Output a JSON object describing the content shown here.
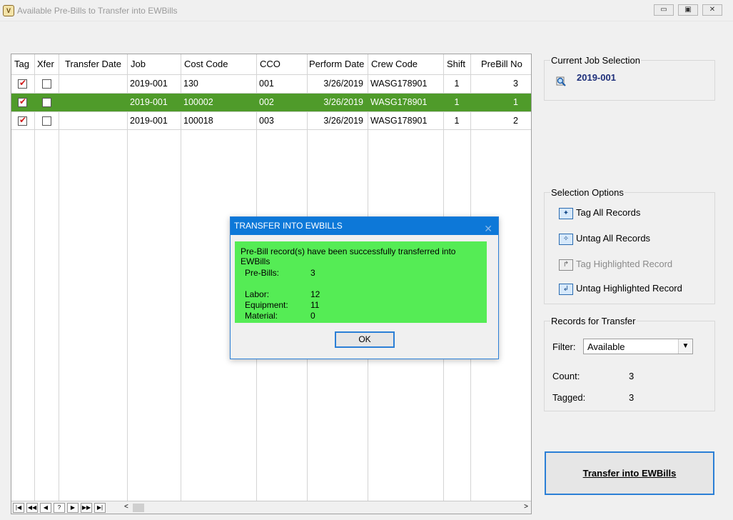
{
  "window": {
    "title": "Available Pre-Bills to Transfer into EWBills",
    "app_icon": "app-icon",
    "min_glyph": "▭",
    "max_glyph": "▣",
    "close_glyph": "✕"
  },
  "grid": {
    "columns": [
      "Tag",
      "Xfer",
      "Transfer Date",
      "Job",
      "Cost Code",
      "CCO",
      "Perform Date",
      "Crew Code",
      "Shift",
      "PreBill No"
    ],
    "rows": [
      {
        "tag": true,
        "xfer": false,
        "transfer_date": "",
        "job": "2019-001",
        "cost_code": "130",
        "cco": "001",
        "perform_date": "3/26/2019",
        "crew_code": "WASG178901",
        "shift": "1",
        "prebill_no": "3",
        "selected": false
      },
      {
        "tag": true,
        "xfer": false,
        "transfer_date": "",
        "job": "2019-001",
        "cost_code": "100002",
        "cco": "002",
        "perform_date": "3/26/2019",
        "crew_code": "WASG178901",
        "shift": "1",
        "prebill_no": "1",
        "selected": true
      },
      {
        "tag": true,
        "xfer": false,
        "transfer_date": "",
        "job": "2019-001",
        "cost_code": "100018",
        "cco": "003",
        "perform_date": "3/26/2019",
        "crew_code": "WASG178901",
        "shift": "1",
        "prebill_no": "2",
        "selected": false
      }
    ],
    "nav": [
      "|◀",
      "◀◀",
      "◀",
      "?",
      "▶",
      "▶▶",
      "▶|"
    ],
    "scroll_left": "<",
    "scroll_right": ">"
  },
  "job_selection": {
    "title": "Current Job Selection",
    "value": "2019-001",
    "icon": "magnifier-icon"
  },
  "selection_options": {
    "title": "Selection Options",
    "tag_all": "Tag All Records",
    "untag_all": "Untag All Records",
    "tag_highlighted": "Tag Highlighted Record",
    "untag_highlighted": "Untag Highlighted Record"
  },
  "records": {
    "title": "Records for Transfer",
    "filter_label": "Filter:",
    "filter_value": "Available",
    "count_label": "Count:",
    "count_value": "3",
    "tagged_label": "Tagged:",
    "tagged_value": "3"
  },
  "transfer_button": "Transfer into EWBills",
  "dialog": {
    "title": "TRANSFER INTO EWBILLS",
    "close_glyph": "✕",
    "message": "Pre-Bill record(s) have been successfully transferred into EWBills",
    "prebills_label": "Pre-Bills:",
    "prebills_value": "3",
    "labor_label": "Labor:",
    "labor_value": "12",
    "equipment_label": "Equipment:",
    "equipment_value": "11",
    "material_label": "Material:",
    "material_value": "0",
    "ok": "OK"
  },
  "colors": {
    "selected_row": "#4f9b2a",
    "dialog_body": "#55ec55",
    "dialog_title": "#0d78d8",
    "accent": "#2b7fd6",
    "job_value": "#1e2f7a"
  }
}
